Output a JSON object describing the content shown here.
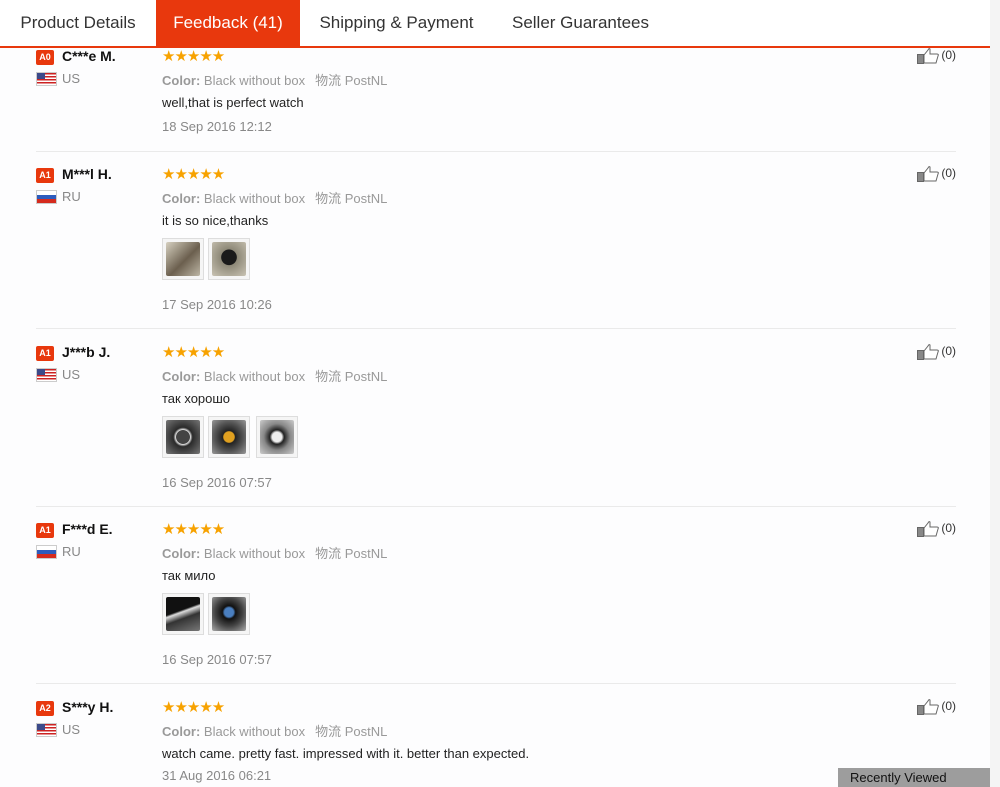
{
  "tabs": [
    "Product Details",
    "Feedback (41)",
    "Shipping & Payment",
    "Seller Guarantees"
  ],
  "stars": "★★★★★",
  "color_label": "Color:",
  "ship_label": "物流",
  "reviews": [
    {
      "badge": "A0",
      "user": "C***e M.",
      "country": "US",
      "color": "Black without box",
      "ship": "PostNL",
      "text": "well,that is perfect watch",
      "date": "18 Sep 2016 12:12",
      "likes": "(0)"
    },
    {
      "badge": "A1",
      "user": "M***l H.",
      "country": "RU",
      "color": "Black without box",
      "ship": "PostNL",
      "text": "it is so nice,thanks",
      "date": "17 Sep 2016 10:26",
      "likes": "(0)"
    },
    {
      "badge": "A1",
      "user": "J***b J.",
      "country": "US",
      "color": "Black without box",
      "ship": "PostNL",
      "text": "так хорошо",
      "date": "16 Sep 2016 07:57",
      "likes": "(0)"
    },
    {
      "badge": "A1",
      "user": "F***d E.",
      "country": "RU",
      "color": "Black without box",
      "ship": "PostNL",
      "text": "так мило",
      "date": "16 Sep 2016 07:57",
      "likes": "(0)"
    },
    {
      "badge": "A2",
      "user": "S***y H.",
      "country": "US",
      "color": "Black without box",
      "ship": "PostNL",
      "text": "watch came. pretty fast. impressed with it. better than expected.",
      "date": "31 Aug 2016 06:21",
      "likes": "(0)"
    }
  ],
  "recently_viewed": "Recently Viewed"
}
